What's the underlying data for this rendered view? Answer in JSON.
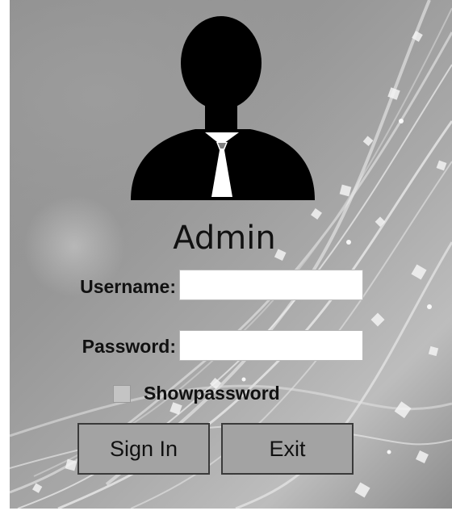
{
  "login_panel": {
    "title": "Admin",
    "avatar_icon": "user-silhouette-icon",
    "username": {
      "label": "Username:",
      "value": "",
      "placeholder": ""
    },
    "password": {
      "label": "Password:",
      "value": "",
      "placeholder": ""
    },
    "show_password": {
      "label": "Showpassword",
      "checked": false
    },
    "buttons": {
      "signin_label": "Sign In",
      "exit_label": "Exit"
    }
  },
  "colors": {
    "background": "#9a9a9a",
    "button_fill": "#a3a3a3",
    "button_border": "#3a3a3a",
    "text": "#111111",
    "input_fill": "#ffffff"
  }
}
